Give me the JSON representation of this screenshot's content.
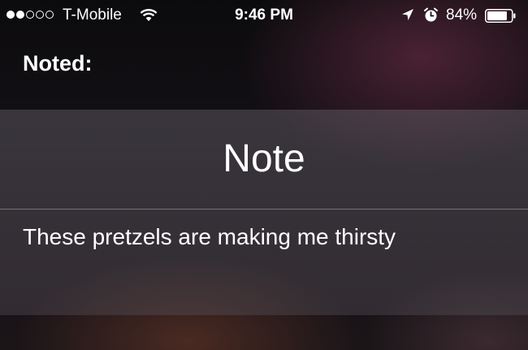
{
  "status_bar": {
    "signal_strength": "2 of 5",
    "carrier": "T-Mobile",
    "wifi_icon": "wifi-icon",
    "time": "9:46 PM",
    "location_icon": "location-arrow-icon",
    "alarm_icon": "alarm-clock-icon",
    "battery_percent": "84%",
    "battery_level": 0.84
  },
  "siri": {
    "heading": "Noted:"
  },
  "note": {
    "title": "Note",
    "body": "These pretzels are making me thirsty"
  }
}
